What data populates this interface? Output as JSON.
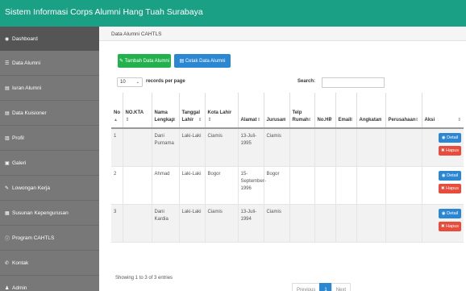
{
  "app": {
    "title": "Sistem Informasi Corps Alumni Hang Tuah Surabaya"
  },
  "sidebar": {
    "items": [
      {
        "label": "Dashboard",
        "icon": "dashboard-icon",
        "glyph": "◉"
      },
      {
        "label": "Data Alumni",
        "icon": "list-icon",
        "glyph": "☰"
      },
      {
        "label": "Iuran Alumni",
        "icon": "table-icon",
        "glyph": "▤"
      },
      {
        "label": "Data Kuisioner",
        "icon": "table-icon",
        "glyph": "▤"
      },
      {
        "label": "Profil",
        "icon": "building-icon",
        "glyph": "▥"
      },
      {
        "label": "Galeri",
        "icon": "image-icon",
        "glyph": "▣"
      },
      {
        "label": "Lowongan Kerja",
        "icon": "edit-icon",
        "glyph": "✎"
      },
      {
        "label": "Susunan Kepengurusan",
        "icon": "grid-icon",
        "glyph": "▦"
      },
      {
        "label": "Program CAHTLS",
        "icon": "info-icon",
        "glyph": "ⓘ"
      },
      {
        "label": "Kontak",
        "icon": "phone-icon",
        "glyph": "✆"
      },
      {
        "label": "Admin",
        "icon": "user-icon",
        "glyph": "♟"
      }
    ]
  },
  "main": {
    "breadcrumb": "Data Alumni CAHTLS",
    "add_button": "Tambah Data Alumni",
    "print_button": "Cetak Data Alumni",
    "length_value": "10",
    "length_label": "records per page",
    "search_label": "Search:",
    "search_value": ""
  },
  "table": {
    "columns": [
      {
        "label": "No",
        "sort": "▲"
      },
      {
        "label": "NO.KTA",
        "sort": "⇕"
      },
      {
        "label": "Nama Lengkap",
        "sort": "⇕"
      },
      {
        "label": "Tanggal Lahir",
        "sort": "⇕"
      },
      {
        "label": "Kota Lahir",
        "sort": "⇕"
      },
      {
        "label": "Alamat",
        "sort": "⇕"
      },
      {
        "label": "Jurusan",
        "sort": "⇕"
      },
      {
        "label": "Telp Rumah",
        "sort": "⇕"
      },
      {
        "label": "No.HP",
        "sort": "⇕"
      },
      {
        "label": "Email",
        "sort": "⇕"
      },
      {
        "label": "Angkatan",
        "sort": "⇕"
      },
      {
        "label": "Perusahaan",
        "sort": "⇕"
      },
      {
        "label": "Aksi",
        "sort": "⇕"
      }
    ],
    "rows": [
      {
        "no": "1",
        "kta": "",
        "nama": "Dani Purnama",
        "tgl": "Laki-Laki",
        "kota": "Ciamis",
        "alamat": "13-Juli-1995",
        "jurusan": "Ciamis",
        "telp": "",
        "hp": "",
        "email": "",
        "angkatan": "",
        "perusahaan": "",
        "detail": "Detail",
        "hapus": "Hapus"
      },
      {
        "no": "2",
        "kta": "",
        "nama": "Ahmad",
        "tgl": "Laki-Laki",
        "kota": "Bogor",
        "alamat": "15-September-1996",
        "jurusan": "Bogor",
        "telp": "",
        "hp": "",
        "email": "",
        "angkatan": "",
        "perusahaan": "",
        "detail": "Detail",
        "hapus": "Hapus"
      },
      {
        "no": "3",
        "kta": "",
        "nama": "Dani Kardia",
        "tgl": "Laki-Laki",
        "kota": "Ciamis",
        "alamat": "13-Juli-1994",
        "jurusan": "Ciamis",
        "telp": "",
        "hp": "",
        "email": "",
        "angkatan": "",
        "perusahaan": "",
        "detail": "Detail",
        "hapus": "Hapus"
      }
    ]
  },
  "footer": {
    "info": "Showing 1 to 3 of 3 entries",
    "previous": "Previous",
    "page": "1",
    "next": "Next"
  },
  "colors": {
    "topbar": "#1aa085",
    "sidebar": "#787878",
    "primary": "#2b87d1",
    "success": "#22b14c",
    "danger": "#e74c3c"
  }
}
